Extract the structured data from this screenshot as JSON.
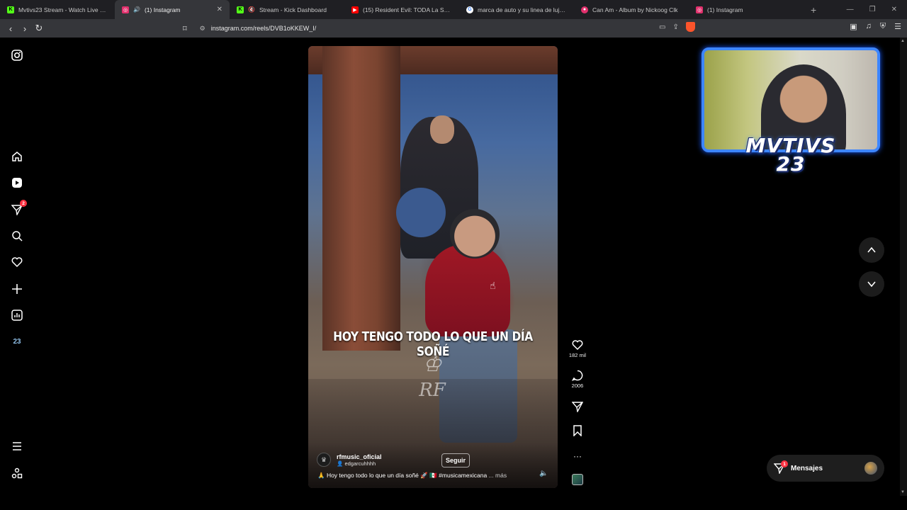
{
  "browser": {
    "tabs": [
      {
        "title": "Mvtivs23 Stream - Watch Live on Kick",
        "favicon": "kick-icon",
        "color": "#53fc18",
        "active": false
      },
      {
        "title": "(1) Instagram",
        "favicon": "instagram-icon",
        "color": "#e1306c",
        "active": true
      },
      {
        "title": "Stream - Kick Dashboard",
        "favicon": "kick-icon",
        "color": "#53fc18",
        "active": false
      },
      {
        "title": "(15) Resident Evil: TODA La Saga en",
        "favicon": "youtube-icon",
        "color": "#ff0000",
        "active": false
      },
      {
        "title": "marca de auto y su linea de lujo - Bu",
        "favicon": "google-icon",
        "color": "#4285f4",
        "active": false
      },
      {
        "title": "Can Am - Album by Nickoog Clk",
        "favicon": "spotify-icon",
        "color": "#e1306c",
        "active": false
      },
      {
        "title": "(1) Instagram",
        "favicon": "instagram-icon",
        "color": "#e1306c",
        "active": false
      }
    ],
    "new_tab": "+",
    "url": "instagram.com/reels/DVB1oKKEW_I/"
  },
  "sidebar": {
    "notification_count": "2",
    "stats_label": "23"
  },
  "reel": {
    "overlay_text": "HOY TENGO TODO LO QUE UN DÍA SOÑÉ",
    "watermark": "RF",
    "username": "rfmusic_oficial",
    "collab": "edgarcuhhhh",
    "follow_label": "Seguir",
    "description": "🙏 Hoy tengo todo lo que un día soñé 🚀 🇲🇽 #musicamexicana",
    "more_label": "... más",
    "likes": "182 mil",
    "comments": "2006"
  },
  "messages": {
    "label": "Mensajes",
    "badge": "1"
  },
  "webcam": {
    "logo_line1": "MVTIVS",
    "logo_line2": "23"
  },
  "colors": {
    "accent": "#3d86ff",
    "badge": "#ff3040"
  }
}
